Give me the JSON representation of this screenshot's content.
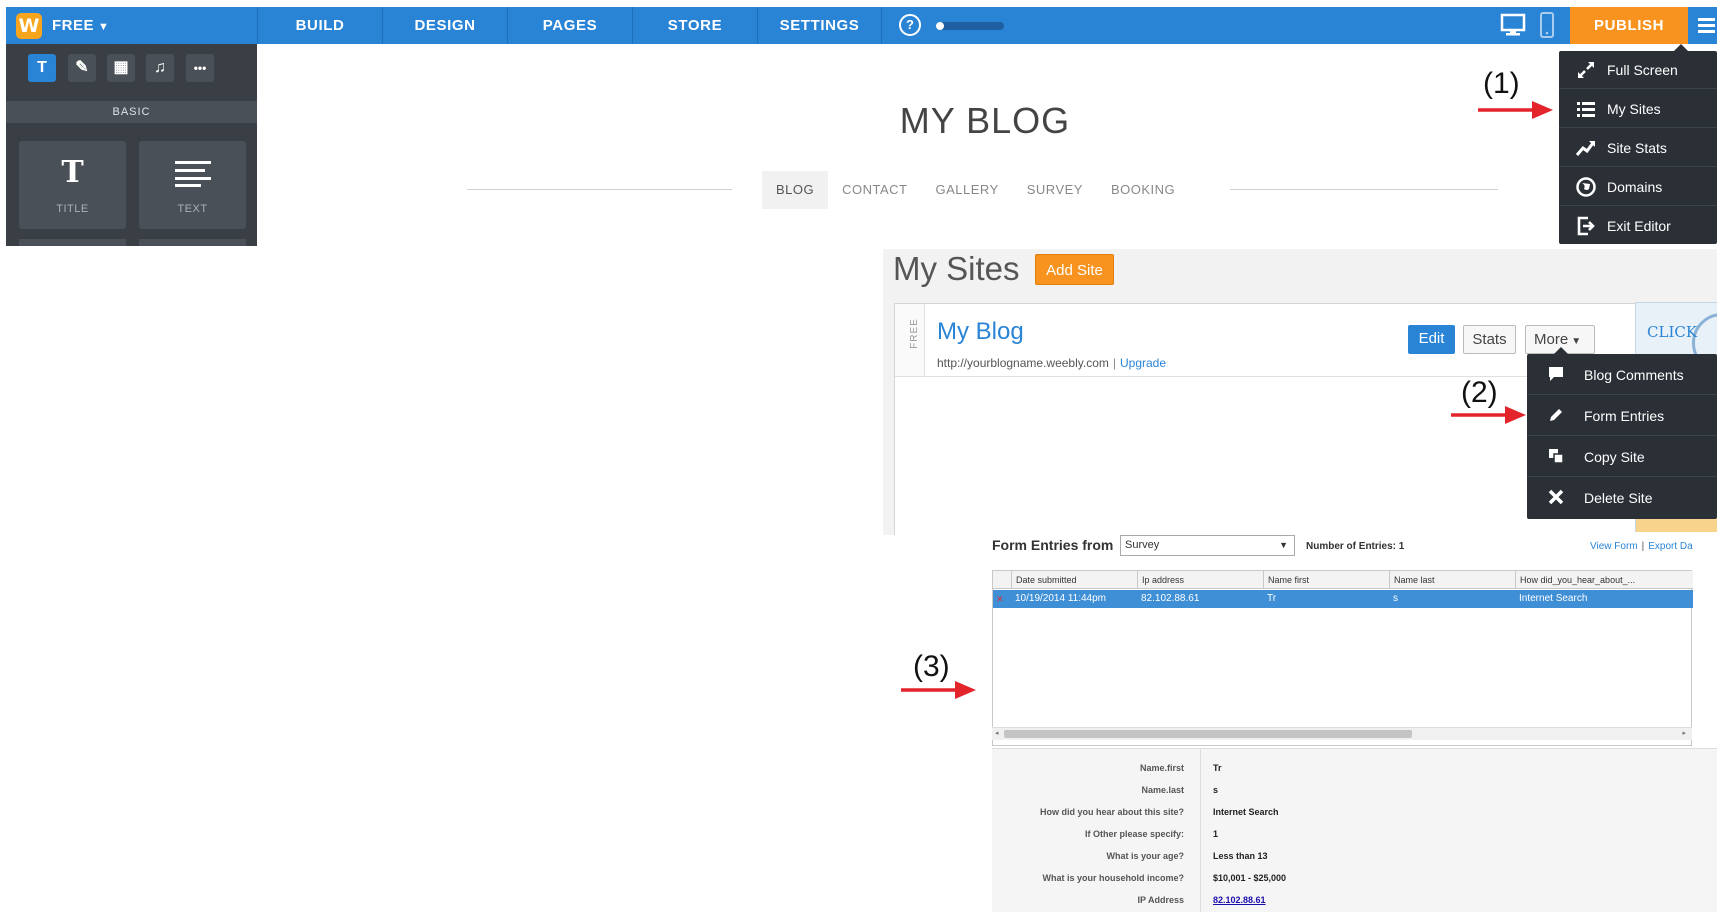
{
  "colors": {
    "brand_blue": "#2a84d6",
    "publish_orange": "#f7931e",
    "logo_orange": "#f7a51c",
    "menu_dark": "#2b3036",
    "annotation_arrow": "#e3242b"
  },
  "editor": {
    "logo_letter": "W",
    "plan": "FREE",
    "tabs": [
      "BUILD",
      "DESIGN",
      "PAGES",
      "STORE",
      "SETTINGS"
    ],
    "help_glyph": "?",
    "progress_fraction": 0.1,
    "publish_label": "PUBLISH",
    "tools": [
      "T",
      "✎",
      "▦",
      "♫",
      "•••"
    ],
    "panel_section": "BASIC",
    "elements": [
      {
        "glyph": "T",
        "label": "TITLE"
      },
      {
        "label": "TEXT",
        "icon": "text-lines-icon"
      }
    ],
    "site": {
      "title": "MY BLOG",
      "nav": [
        "BLOG",
        "CONTACT",
        "GALLERY",
        "SURVEY",
        "BOOKING"
      ],
      "active_nav": "BLOG"
    },
    "menu": [
      {
        "label": "Full Screen",
        "icon": "expand-icon"
      },
      {
        "label": "My Sites",
        "icon": "list-icon"
      },
      {
        "label": "Site Stats",
        "icon": "trend-icon"
      },
      {
        "label": "Domains",
        "icon": "globe-icon"
      },
      {
        "label": "Exit Editor",
        "icon": "exit-icon"
      }
    ]
  },
  "annotations": [
    "(1)",
    "(2)",
    "(3)"
  ],
  "my_sites": {
    "title": "My Sites",
    "add_site_label": "Add Site",
    "free_strip": "FREE",
    "site_name": "My Blog",
    "site_url": "http://yourblogname.weebly.com",
    "url_separator": "|",
    "upgrade_label": "Upgrade",
    "edit_label": "Edit",
    "stats_label": "Stats",
    "more_label": "More",
    "promo_text": "CLICK",
    "more_menu": [
      {
        "label": "Blog Comments",
        "icon": "comment-icon"
      },
      {
        "label": "Form Entries",
        "icon": "pencil-icon"
      },
      {
        "label": "Copy Site",
        "icon": "copy-icon"
      },
      {
        "label": "Delete Site",
        "icon": "delete-icon"
      }
    ]
  },
  "form_entries": {
    "title": "Form Entries from",
    "selected_form": "Survey",
    "count_label": "Number of Entries: 1",
    "link_view": "View Form",
    "link_separator": "|",
    "link_export": "Export Da",
    "columns": [
      "Date submitted",
      "Ip address",
      "Name first",
      "Name last",
      "How did_you_hear_about_..."
    ],
    "rows": [
      [
        "10/19/2014 11:44pm",
        "82.102.88.61",
        "Tr",
        "s",
        "Internet Search"
      ]
    ],
    "row_delete_glyph": "✕",
    "scroll_left_glyph": "◂",
    "scroll_right_glyph": "▸",
    "scroll_fraction": 0.6,
    "details": [
      {
        "key": "Name.first",
        "value": "Tr"
      },
      {
        "key": "Name.last",
        "value": "s"
      },
      {
        "key": "How did you hear about this site?",
        "value": "Internet Search"
      },
      {
        "key": "If Other please specify:",
        "value": "1"
      },
      {
        "key": "What is your age?",
        "value": "Less than 13"
      },
      {
        "key": "What is your household income?",
        "value": "$10,001 - $25,000"
      },
      {
        "key": "IP Address",
        "value": "82.102.88.61",
        "link": true
      }
    ]
  }
}
